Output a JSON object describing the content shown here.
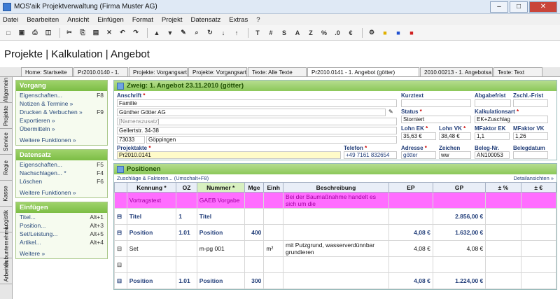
{
  "window": {
    "title": "MOS'aik Projektverwaltung (Firma Muster AG)"
  },
  "menu": [
    "Datei",
    "Bearbeiten",
    "Ansicht",
    "Einfügen",
    "Format",
    "Projekt",
    "Datensatz",
    "Extras",
    "?"
  ],
  "toolbar_icons": [
    "new-icon",
    "open-icon",
    "print-icon",
    "preview-icon",
    "cut-icon",
    "copy-icon",
    "paste-icon",
    "delete-icon",
    "undo-icon",
    "redo-icon",
    "up-icon",
    "down-icon",
    "edit-icon",
    "find-icon",
    "refresh-icon",
    "sort-az-icon",
    "sort-za-icon",
    "T",
    "#",
    "S",
    "A",
    "Z",
    "%",
    "decimal-icon",
    "currency-icon",
    "tool-icon",
    "lock-yellow-icon",
    "lock-blue-icon",
    "lock-red-icon"
  ],
  "page_title": "Projekte | Kalkulation | Angebot",
  "tabs": [
    "Home: Startseite",
    "Pr2010.0140 - 1.",
    "Projekte: Vorgangsart",
    "Projekte: Vorgangsart",
    "Texte: Alle Texte",
    "Pr2010.0141 - 1. Angebot (götter)",
    "2010.00213 - 1. Angebotsa",
    "Texte: Text"
  ],
  "vtabs": [
    "Allgemein",
    "Projekte",
    "Service",
    "Regie",
    "Kasse",
    "Logistik",
    "Subunternehmer",
    "Arbeiten"
  ],
  "sidebar": {
    "vorgang": {
      "title": "Vorgang",
      "items": [
        {
          "label": "Eigenschaften...",
          "key": "F8"
        },
        {
          "label": "Notizen & Termine »",
          "key": ""
        },
        {
          "label": "Drucken & Verbuchen »",
          "key": "F9"
        },
        {
          "label": "Exportieren »",
          "key": ""
        },
        {
          "label": "Übermitteln »",
          "key": ""
        }
      ],
      "more": "Weitere Funktionen »"
    },
    "datensatz": {
      "title": "Datensatz",
      "items": [
        {
          "label": "Eigenschaften...",
          "key": "F5"
        },
        {
          "label": "Nachschlagen... *",
          "key": "F4"
        },
        {
          "label": "Löschen",
          "key": "F6"
        }
      ],
      "more": "Weitere Funktionen »"
    },
    "einfuegen": {
      "title": "Einfügen",
      "items": [
        {
          "label": "Titel...",
          "key": "Alt+1"
        },
        {
          "label": "Position...",
          "key": "Alt+3"
        },
        {
          "label": "Set/Leistung...",
          "key": "Alt+5"
        },
        {
          "label": "Artikel...",
          "key": "Alt+4"
        }
      ],
      "more": "Weitere »"
    }
  },
  "branch": {
    "title": "Zweig: 1. Angebot 23.11.2010 (götter)"
  },
  "form": {
    "anschrift_label": "Anschrift",
    "anrede": "Familie",
    "name": "Günther Götter AG",
    "namenszusatz": "[Namenszusatz]",
    "strasse": "Gellertstr. 34-38",
    "plz": "73033",
    "ort": "Göppingen",
    "projektakte_label": "Projektakte",
    "projektakte": "Pr2010.0141",
    "telefon_label": "Telefon",
    "telefon": "+49 7161 832654",
    "kurztext_label": "Kurztext",
    "status_label": "Status",
    "status": "Storniert",
    "lohn_ek_label": "Lohn EK",
    "lohn_ek": "35,63 €",
    "lohn_vk_label": "Lohn VK",
    "lohn_vk": "38,48 €",
    "adresse_label": "Adresse",
    "adresse": "götter",
    "zeichen_label": "Zeichen",
    "zeichen": "ww",
    "abgabefrist_label": "Abgabefrist",
    "zschl_label": "Zschl.-Frist",
    "kalkulationsart_label": "Kalkulationsart",
    "kalkulationsart": "EK+Zuschlag",
    "mfaktor_ek_label": "MFaktor EK",
    "mfaktor_ek": "1,1",
    "mfaktor_vk_label": "MFaktor VK",
    "mfaktor_vk": "1,26",
    "belegnr_label": "Beleg-Nr.",
    "belegnr": "AN100053",
    "belegdatum_label": "Belegdatum"
  },
  "positions": {
    "title": "Positionen",
    "zuschlaege": "Zuschläge & Faktoren... (Umschalt+F8)",
    "details": "Detailansichten »",
    "headers": [
      "",
      "Kennung *",
      "OZ",
      "Nummer *",
      "Mge",
      "Einh",
      "Beschreibung",
      "EP",
      "GP",
      "± %",
      "± €"
    ],
    "rows": [
      {
        "kennung": "Vortragstext",
        "oz": "",
        "nummer": "GAEB Vorgabe",
        "mge": "",
        "einh": "",
        "beschreibung": "Bei der Baumaßnahme handelt es sich um die",
        "ep": "",
        "gp": "",
        "cls": "pink"
      },
      {
        "kennung": "Titel",
        "oz": "1",
        "nummer": "Titel",
        "mge": "",
        "einh": "",
        "beschreibung": "",
        "ep": "",
        "gp": "2.856,00 €",
        "cls": "bold"
      },
      {
        "kennung": "Position",
        "oz": "1.01",
        "nummer": "Position",
        "mge": "400",
        "einh": "",
        "beschreibung": "",
        "ep": "4,08 €",
        "gp": "1.632,00 €",
        "cls": "bold"
      },
      {
        "kennung": "Set",
        "oz": "",
        "nummer": "m-pg 001",
        "mge": "",
        "einh": "m²",
        "beschreibung": "mit Putzgrund, wasserverdünnbar grundieren",
        "ep": "4,08 €",
        "gp": "4,08 €",
        "cls": ""
      },
      {
        "kennung": "",
        "oz": "",
        "nummer": "",
        "mge": "",
        "einh": "",
        "beschreibung": "",
        "ep": "",
        "gp": "",
        "cls": ""
      },
      {
        "kennung": "Position",
        "oz": "1.01",
        "nummer": "Position",
        "mge": "300",
        "einh": "",
        "beschreibung": "",
        "ep": "4,08 €",
        "gp": "1.224,00 €",
        "cls": "bold"
      }
    ]
  }
}
